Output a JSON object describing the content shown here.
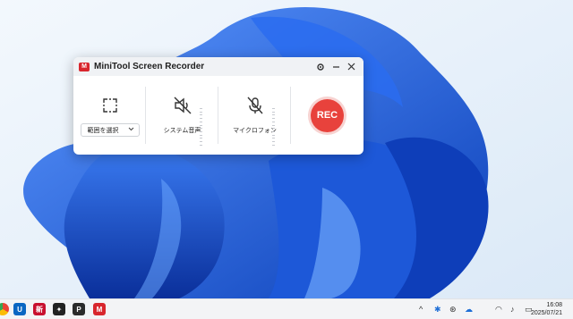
{
  "window": {
    "title": "MiniTool Screen Recorder",
    "logo_text": "M",
    "settings_icon": "gear-icon",
    "minimize_icon": "minimize-icon",
    "close_icon": "close-icon"
  },
  "region": {
    "icon": "region-select-icon",
    "dropdown_value": "範囲を選択",
    "dropdown_icon": "chevron-down-icon"
  },
  "system_audio": {
    "icon": "speaker-muted-icon",
    "label": "システム音声"
  },
  "microphone": {
    "icon": "microphone-muted-icon",
    "label": "マイクロフォン"
  },
  "record": {
    "label": "REC",
    "color": "#e8423c"
  },
  "taskbar": {
    "apps": [
      {
        "name": "chrome-icon",
        "text": ""
      },
      {
        "name": "u-app-icon",
        "text": "U"
      },
      {
        "name": "app-icon-red",
        "text": "新"
      },
      {
        "name": "app-icon-star",
        "text": "✦"
      },
      {
        "name": "app-icon-p",
        "text": "P"
      },
      {
        "name": "minitool-taskbar-icon",
        "text": "M"
      }
    ],
    "time": "16:08",
    "date": "2025/07/21"
  },
  "colors": {
    "accent_red": "#e8423c",
    "wallpaper_blue": "#1f5fe0"
  }
}
